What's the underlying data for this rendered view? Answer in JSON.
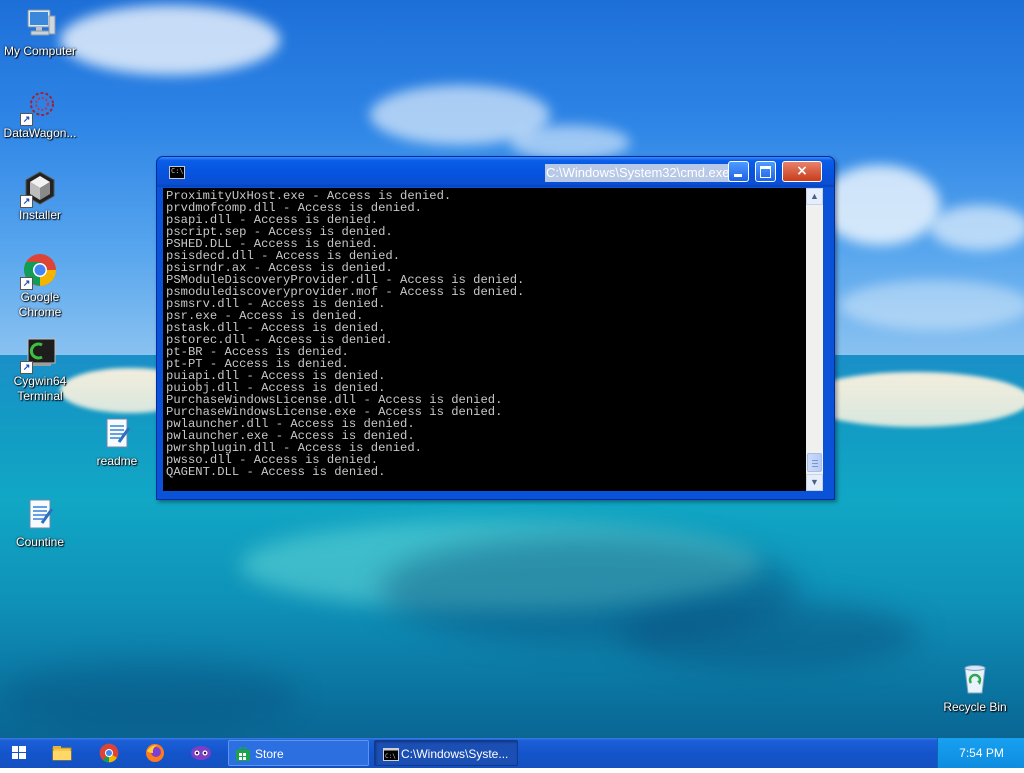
{
  "desktop": {
    "icons": [
      {
        "label": "My Computer",
        "icon": "computer-icon"
      },
      {
        "label": "DataWagon...",
        "icon": "datawagon-icon"
      },
      {
        "label": "Installer",
        "icon": "installer-icon"
      },
      {
        "label_line1": "Google",
        "label_line2": "Chrome",
        "icon": "chrome-icon"
      },
      {
        "label_line1": "Cygwin64",
        "label_line2": "Terminal",
        "icon": "cygwin-terminal-icon"
      },
      {
        "label": "readme",
        "icon": "notepad-document-icon"
      },
      {
        "label": "Countine",
        "icon": "notepad-document-icon"
      },
      {
        "label": "Recycle Bin",
        "icon": "recycle-bin-icon"
      }
    ]
  },
  "cmd_window": {
    "title": "C:\\Windows\\System32\\cmd.exe",
    "controls": {
      "minimize": "minimize",
      "maximize": "maximize",
      "close": "×"
    },
    "lines": [
      "ProximityUxHost.exe - Access is denied.",
      "prvdmofcomp.dll - Access is denied.",
      "psapi.dll - Access is denied.",
      "pscript.sep - Access is denied.",
      "PSHED.DLL - Access is denied.",
      "psisdecd.dll - Access is denied.",
      "psisrndr.ax - Access is denied.",
      "PSModuleDiscoveryProvider.dll - Access is denied.",
      "psmodulediscoveryprovider.mof - Access is denied.",
      "psmsrv.dll - Access is denied.",
      "psr.exe - Access is denied.",
      "pstask.dll - Access is denied.",
      "pstorec.dll - Access is denied.",
      "pt-BR - Access is denied.",
      "pt-PT - Access is denied.",
      "puiapi.dll - Access is denied.",
      "puiobj.dll - Access is denied.",
      "PurchaseWindowsLicense.dll - Access is denied.",
      "PurchaseWindowsLicense.exe - Access is denied.",
      "pwlauncher.dll - Access is denied.",
      "pwlauncher.exe - Access is denied.",
      "pwrshplugin.dll - Access is denied.",
      "pwsso.dll - Access is denied.",
      "QAGENT.DLL - Access is denied."
    ]
  },
  "taskbar": {
    "pinned": [
      "windows-start-icon",
      "file-explorer-icon",
      "chrome-icon",
      "firefox-icon",
      "tor-browser-icon"
    ],
    "buttons": [
      {
        "label": "Store",
        "icon": "store-icon",
        "active": false
      },
      {
        "label": "C:\\Windows\\Syste...",
        "icon": "cmd-icon",
        "active": true
      }
    ],
    "clock": "7:54 PM"
  },
  "colors": {
    "title_bar": "#0654e0",
    "console_bg": "#000000",
    "console_text": "#c8c8c8",
    "taskbar": "#1455cc",
    "tray": "#0e8ce0"
  }
}
